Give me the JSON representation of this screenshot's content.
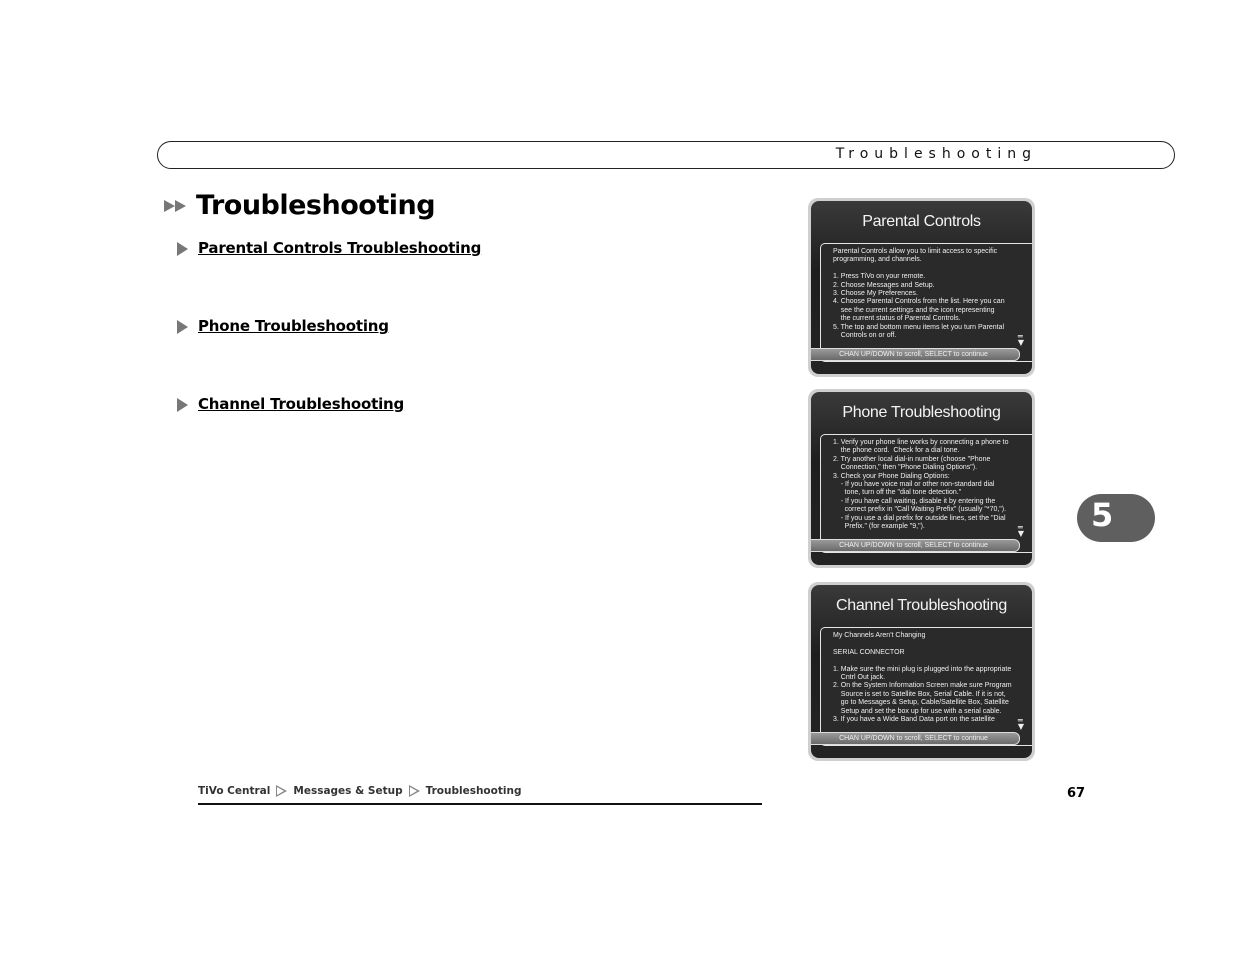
{
  "header": {
    "title": "Troubleshooting"
  },
  "page_title": "Troubleshooting",
  "links": [
    {
      "label": "Parental Controls Troubleshooting"
    },
    {
      "label": "Phone Troubleshooting"
    },
    {
      "label": "Channel Troubleshooting"
    }
  ],
  "screens": [
    {
      "title": "Parental Controls",
      "body": "Parental Controls allow you to limit access to specific\nprogramming, and channels.\n\n1. Press TiVo on your remote.\n2. Choose Messages and Setup.\n3. Choose My Preferences.\n4. Choose Parental Controls from the list. Here you can\n    see the current settings and the icon representing\n    the current status of Parental Controls.\n5. The top and bottom menu items let you turn Parental\n    Controls on or off.",
      "footer": "CHAN UP/DOWN to scroll, SELECT to continue"
    },
    {
      "title": "Phone Troubleshooting",
      "body": "1. Verify your phone line works by connecting a phone to\n    the phone cord.  Check for a dial tone.\n2. Try another local dial-in number (choose \"Phone\n    Connection,\" then \"Phone Dialing Options\").\n3. Check your Phone Dialing Options:\n    - If you have voice mail or other non-standard dial\n      tone, turn off the \"dial tone detection.\"\n    - If you have call waiting, disable it by entering the\n      correct prefix in \"Call Waiting Prefix\" (usually \"*70,\").\n    - If you use a dial prefix for outside lines, set the \"Dial\n      Prefix.\" (for example \"9,\").",
      "footer": "CHAN UP/DOWN to scroll, SELECT to continue"
    },
    {
      "title": "Channel Troubleshooting",
      "body": "My Channels Aren't Changing\n\nSERIAL CONNECTOR\n\n1. Make sure the mini plug is plugged into the appropriate\n    Cntrl Out jack.\n2. On the System Information Screen make sure Program\n    Source is set to Satellite Box, Serial Cable. If it is not,\n    go to Messages & Setup, Cable/Satellite Box, Satellite\n    Setup and set the box up for use with a serial cable.\n3. If you have a Wide Band Data port on the satellite",
      "footer": "CHAN UP/DOWN to scroll, SELECT to continue"
    }
  ],
  "breadcrumb": [
    "TiVo Central",
    "Messages & Setup",
    "Troubleshooting"
  ],
  "page_number": "67",
  "chapter_number": "5"
}
